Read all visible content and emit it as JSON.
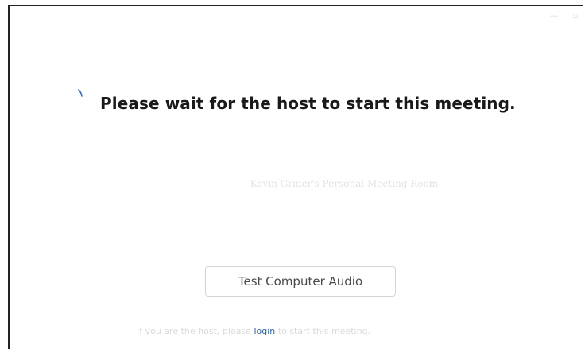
{
  "window": {
    "controls": [
      {
        "name": "minimize",
        "glyph": "—"
      },
      {
        "name": "maximize",
        "glyph": "▫"
      }
    ]
  },
  "waiting": {
    "headline": "Please wait for the host to start this meeting.",
    "spinner_icon": "loading-spinner-icon",
    "spinner_color": "#2d6fd6"
  },
  "meeting": {
    "room_name": "Kevin Grider's Personal Meeting Room"
  },
  "actions": {
    "test_audio_label": "Test Computer Audio"
  },
  "login_prompt": {
    "before": "If you are the host, please ",
    "link": "login",
    "after": " to start this meeting."
  }
}
